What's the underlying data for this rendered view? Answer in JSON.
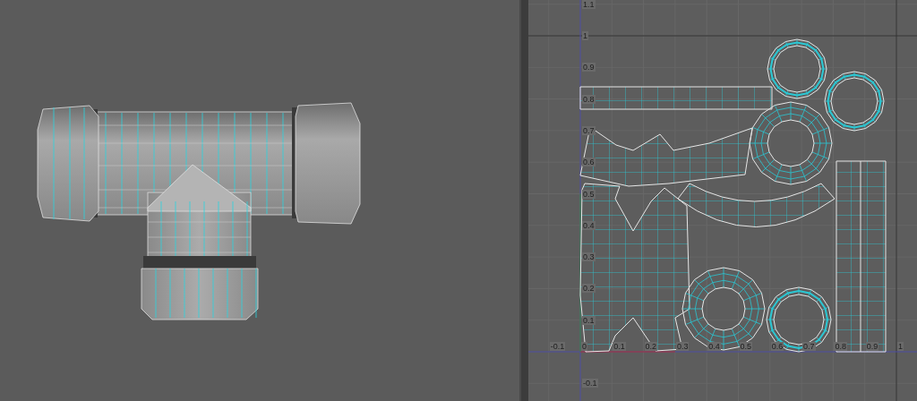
{
  "uv_editor": {
    "u_ticks": [
      "-0.1",
      "0",
      "0.1",
      "0.2",
      "0.3",
      "0.4",
      "0.5",
      "0.6",
      "0.7",
      "0.8",
      "0.9",
      "1"
    ],
    "v_ticks": [
      "1.1",
      "1",
      "0.9",
      "0.8",
      "0.7",
      "0.6",
      "0.5",
      "0.4",
      "0.3",
      "0.2",
      "0.1",
      "-0.1"
    ]
  }
}
